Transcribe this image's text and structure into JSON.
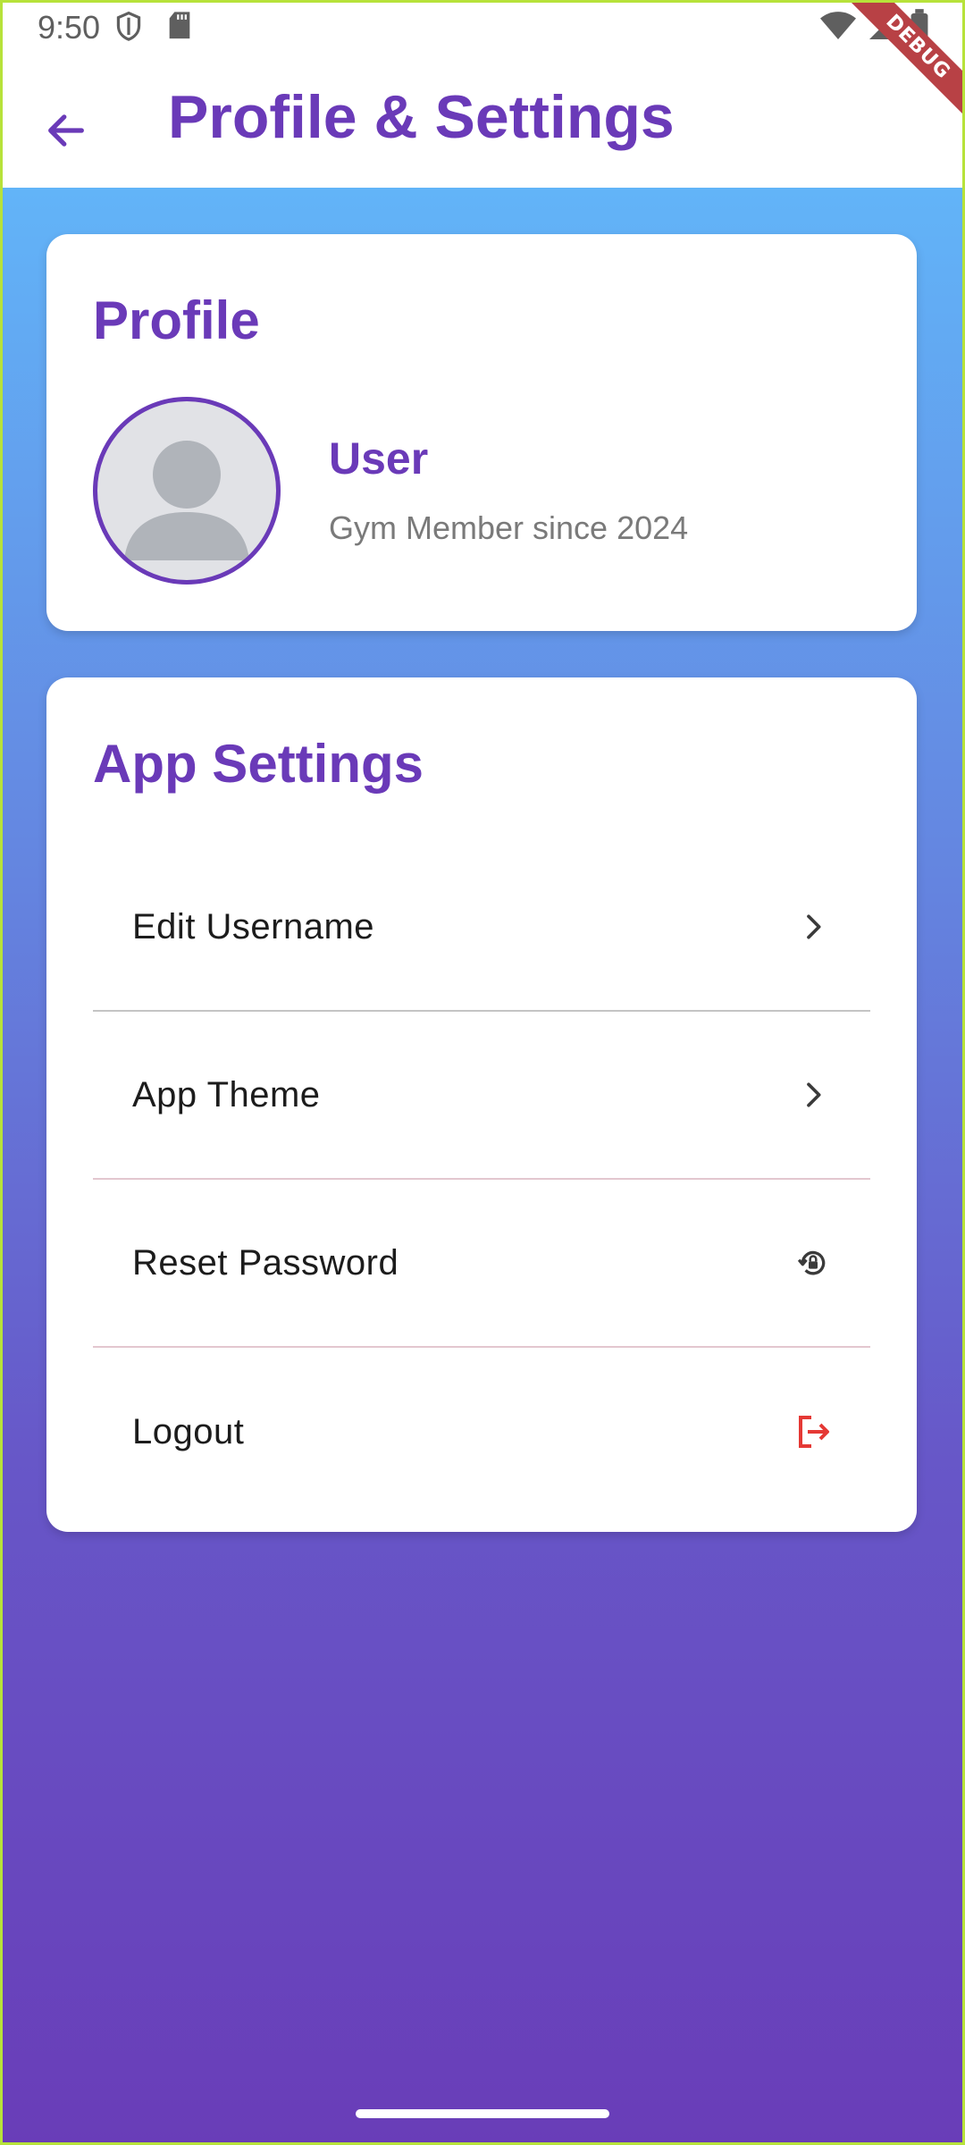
{
  "status_bar": {
    "time": "9:50"
  },
  "debug_banner": "DEBUG",
  "app_bar": {
    "title": "Profile & Settings"
  },
  "profile_card": {
    "title": "Profile",
    "user_name": "User",
    "subtitle": "Gym Member since 2024"
  },
  "settings_card": {
    "title": "App Settings",
    "items": [
      {
        "label": "Edit Username",
        "icon": "chevron-right-icon"
      },
      {
        "label": "App Theme",
        "icon": "chevron-right-icon"
      },
      {
        "label": "Reset Password",
        "icon": "lock-reset-icon"
      },
      {
        "label": "Logout",
        "icon": "logout-icon"
      }
    ]
  },
  "colors": {
    "accent": "#6a3ab8",
    "logout": "#e53935",
    "gradient_top": "#62b4f8",
    "gradient_bottom": "#693db8"
  }
}
